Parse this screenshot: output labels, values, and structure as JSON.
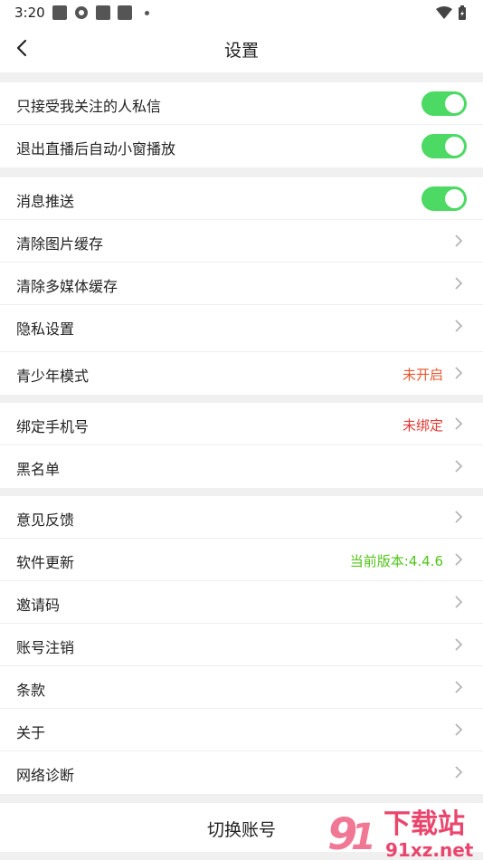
{
  "status": {
    "time": "3:20"
  },
  "header": {
    "title": "设置"
  },
  "groups": [
    {
      "rows": [
        {
          "label": "只接受我关注的人私信",
          "toggle": true
        },
        {
          "label": "退出直播后自动小窗播放",
          "toggle": true
        }
      ]
    },
    {
      "rows": [
        {
          "label": "消息推送",
          "toggle": true
        },
        {
          "label": "清除图片缓存"
        },
        {
          "label": "清除多媒体缓存"
        },
        {
          "label": "隐私设置"
        },
        {
          "label": "青少年模式",
          "value": "未开启",
          "value_color": "#e8572e"
        }
      ]
    },
    {
      "rows": [
        {
          "label": "绑定手机号",
          "value": "未绑定",
          "value_color": "#e53935"
        },
        {
          "label": "黑名单"
        }
      ]
    },
    {
      "rows": [
        {
          "label": "意见反馈"
        },
        {
          "label": "软件更新",
          "value": "当前版本:4.4.6",
          "value_color": "#52c41a"
        },
        {
          "label": "邀请码"
        },
        {
          "label": "账号注销"
        },
        {
          "label": "条款"
        },
        {
          "label": "关于"
        },
        {
          "label": "网络诊断"
        }
      ]
    }
  ],
  "footer": {
    "switch_account": "切换账号"
  },
  "watermark": {
    "brand": "下载站",
    "site": "91xz.net"
  }
}
